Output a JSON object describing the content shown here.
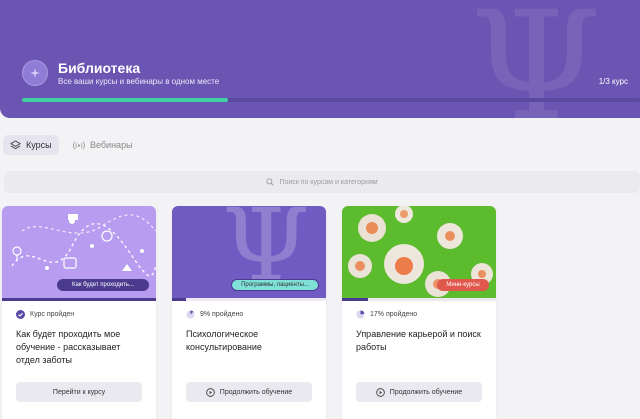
{
  "hero": {
    "title": "Библиотека",
    "subtitle": "Все ваши курсы и вебинары в одном месте",
    "progress_text": "1/3 курс",
    "progress_fraction": 0.333,
    "bg_color": "#6a55b3",
    "progress_color": "#3ecfa3"
  },
  "tabs": [
    {
      "label": "Курсы",
      "icon": "layers-icon",
      "active": true
    },
    {
      "label": "Вебинары",
      "icon": "broadcast-icon",
      "active": false
    }
  ],
  "search": {
    "placeholder": "Поиск по курсам и категориям",
    "icon": "search-icon"
  },
  "cards": [
    {
      "badge": "Как будет проходить...",
      "status": "Курс пройден",
      "status_icon": "check-circle-icon",
      "title": "Как будет проходить мое обучение - рассказывает отдел заботы",
      "button": "Перейти к курсу",
      "progress_fraction": 1.0
    },
    {
      "badge": "Программы, пациенты...",
      "status": "9% пройдено",
      "status_icon": "pie-progress-icon",
      "title": "Психологическое консультирование",
      "button": "Продолжить обучение",
      "button_icon": "play-circle-icon",
      "progress_fraction": 0.09
    },
    {
      "badge": "Мини-курсы",
      "status": "17% пройдено",
      "status_icon": "pie-progress-icon",
      "title": "Управление карьерой и поиск работы",
      "button": "Продолжить обучение",
      "button_icon": "play-circle-icon",
      "progress_fraction": 0.17
    }
  ]
}
